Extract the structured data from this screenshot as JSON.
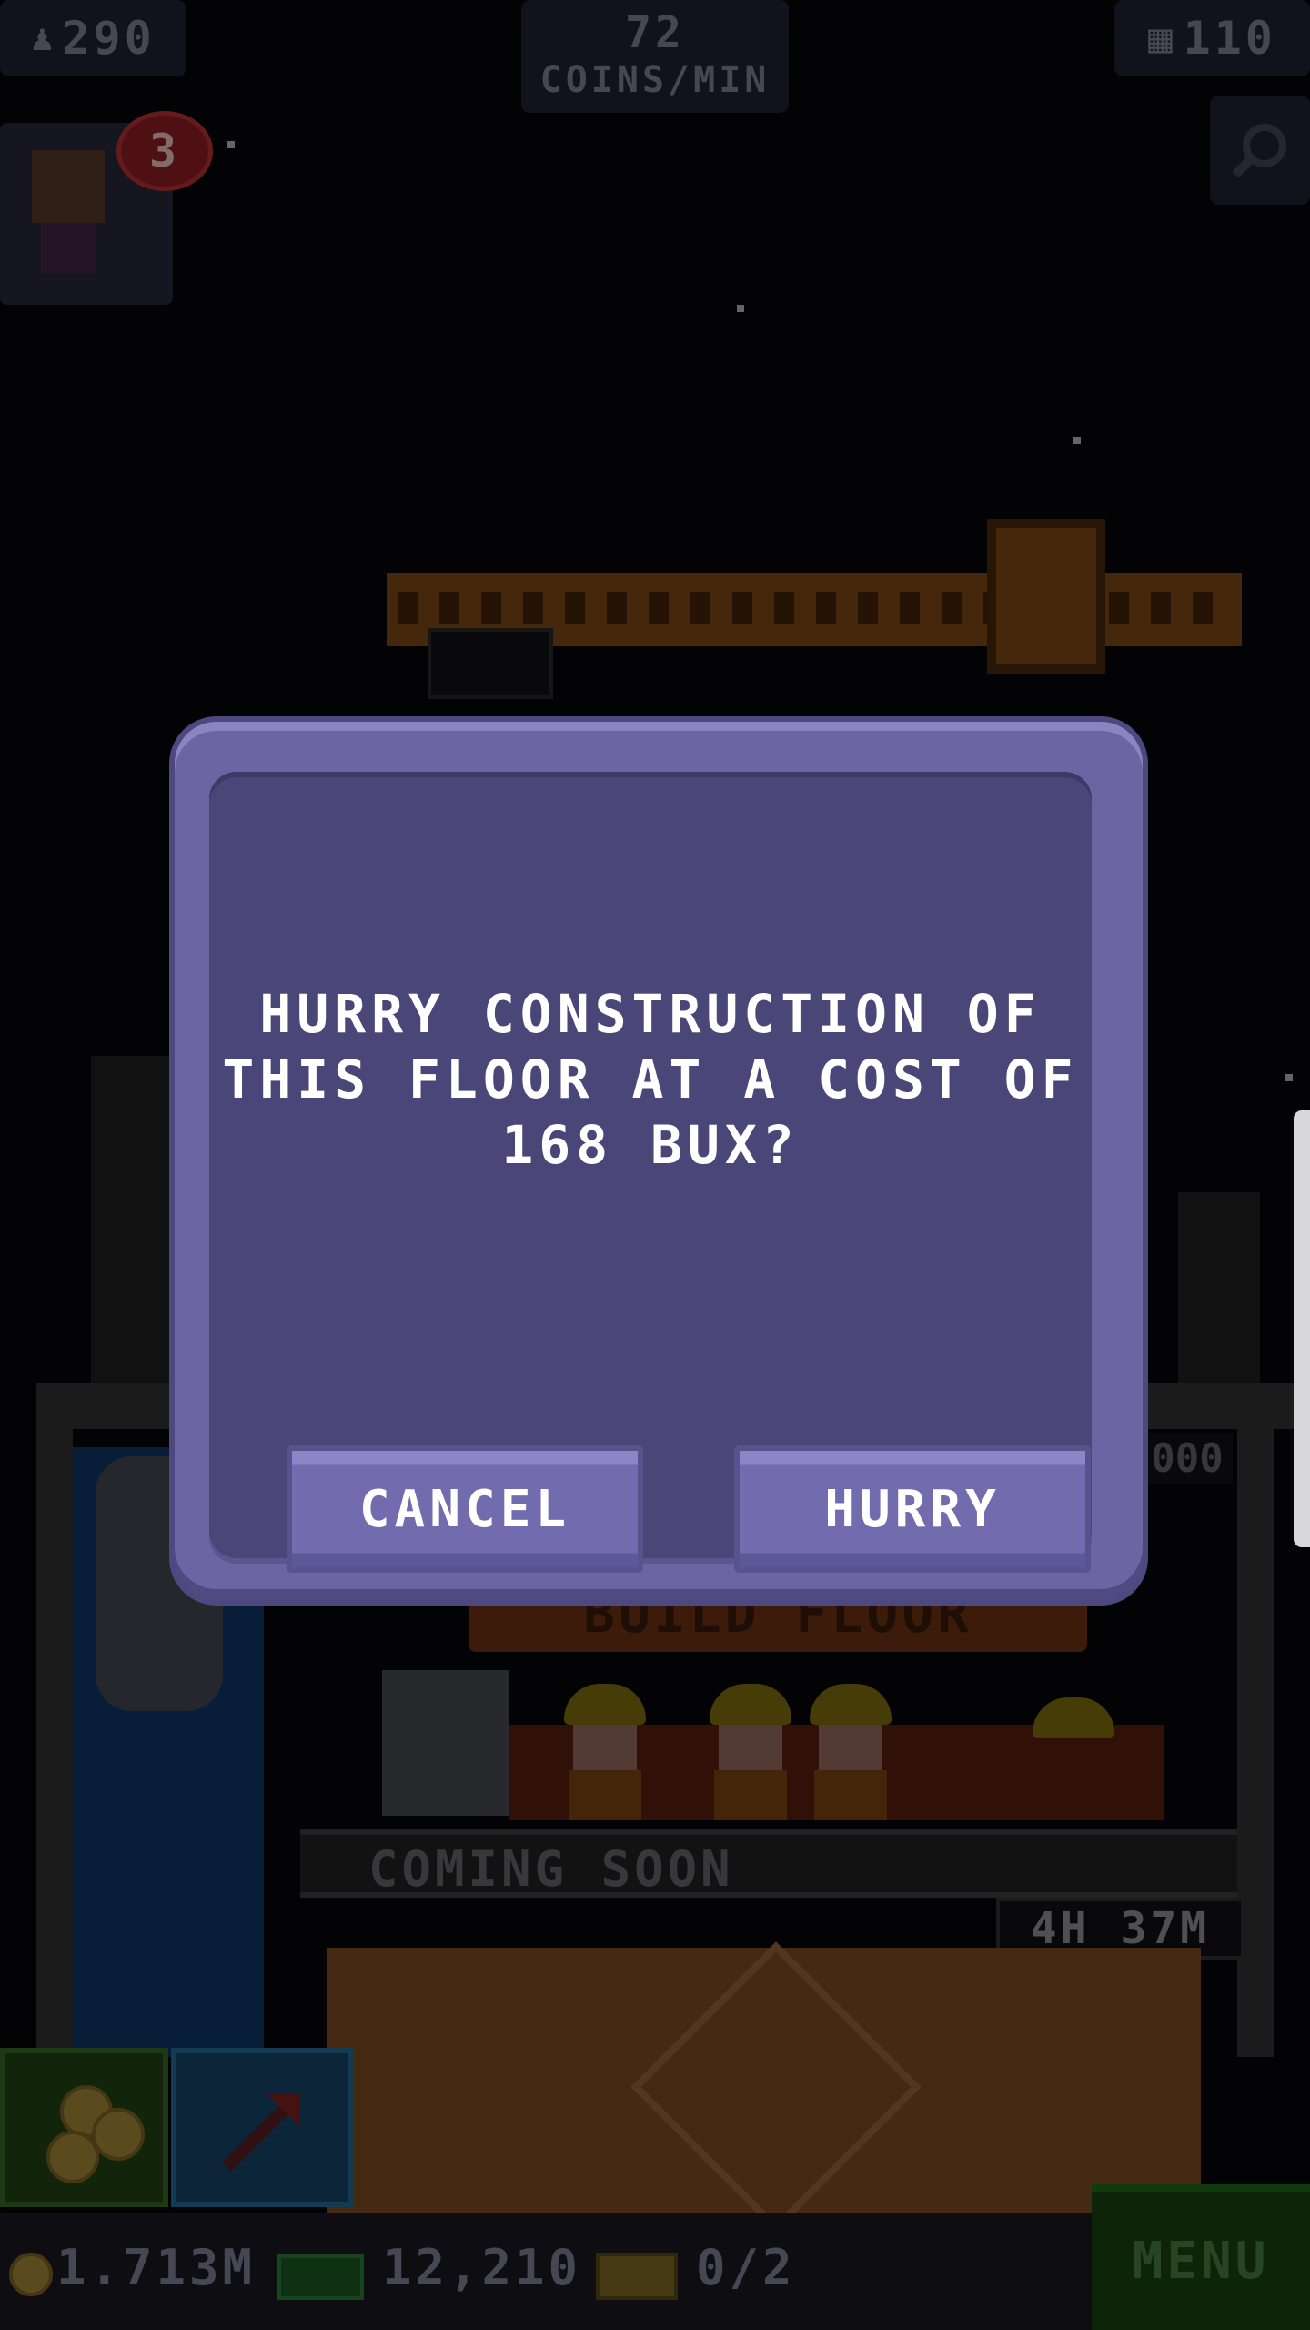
{
  "hud": {
    "population": "290",
    "coins_rate_value": "72",
    "coins_rate_unit": "COINS/MIN",
    "floors": "110",
    "notification_count": "3"
  },
  "scene": {
    "coming_soon": "COMING SOON",
    "timer": "4H 37M",
    "build_floor": "BUILD FLOOR",
    "partial_amount": "000"
  },
  "bottom_bar": {
    "coins": "1.713M",
    "bux": "12,210",
    "vip": "0/2",
    "menu": "MENU"
  },
  "dialog": {
    "line1": "HURRY CONSTRUCTION OF",
    "line2": "THIS FLOOR AT A COST OF",
    "line3": "168 BUX?",
    "cancel": "CANCEL",
    "hurry": "HURRY"
  },
  "icons": [
    "person-icon",
    "building-icon",
    "search-icon",
    "coin-icon",
    "bux-icon",
    "vip-ticket-icon",
    "raise-arrow-icon"
  ]
}
